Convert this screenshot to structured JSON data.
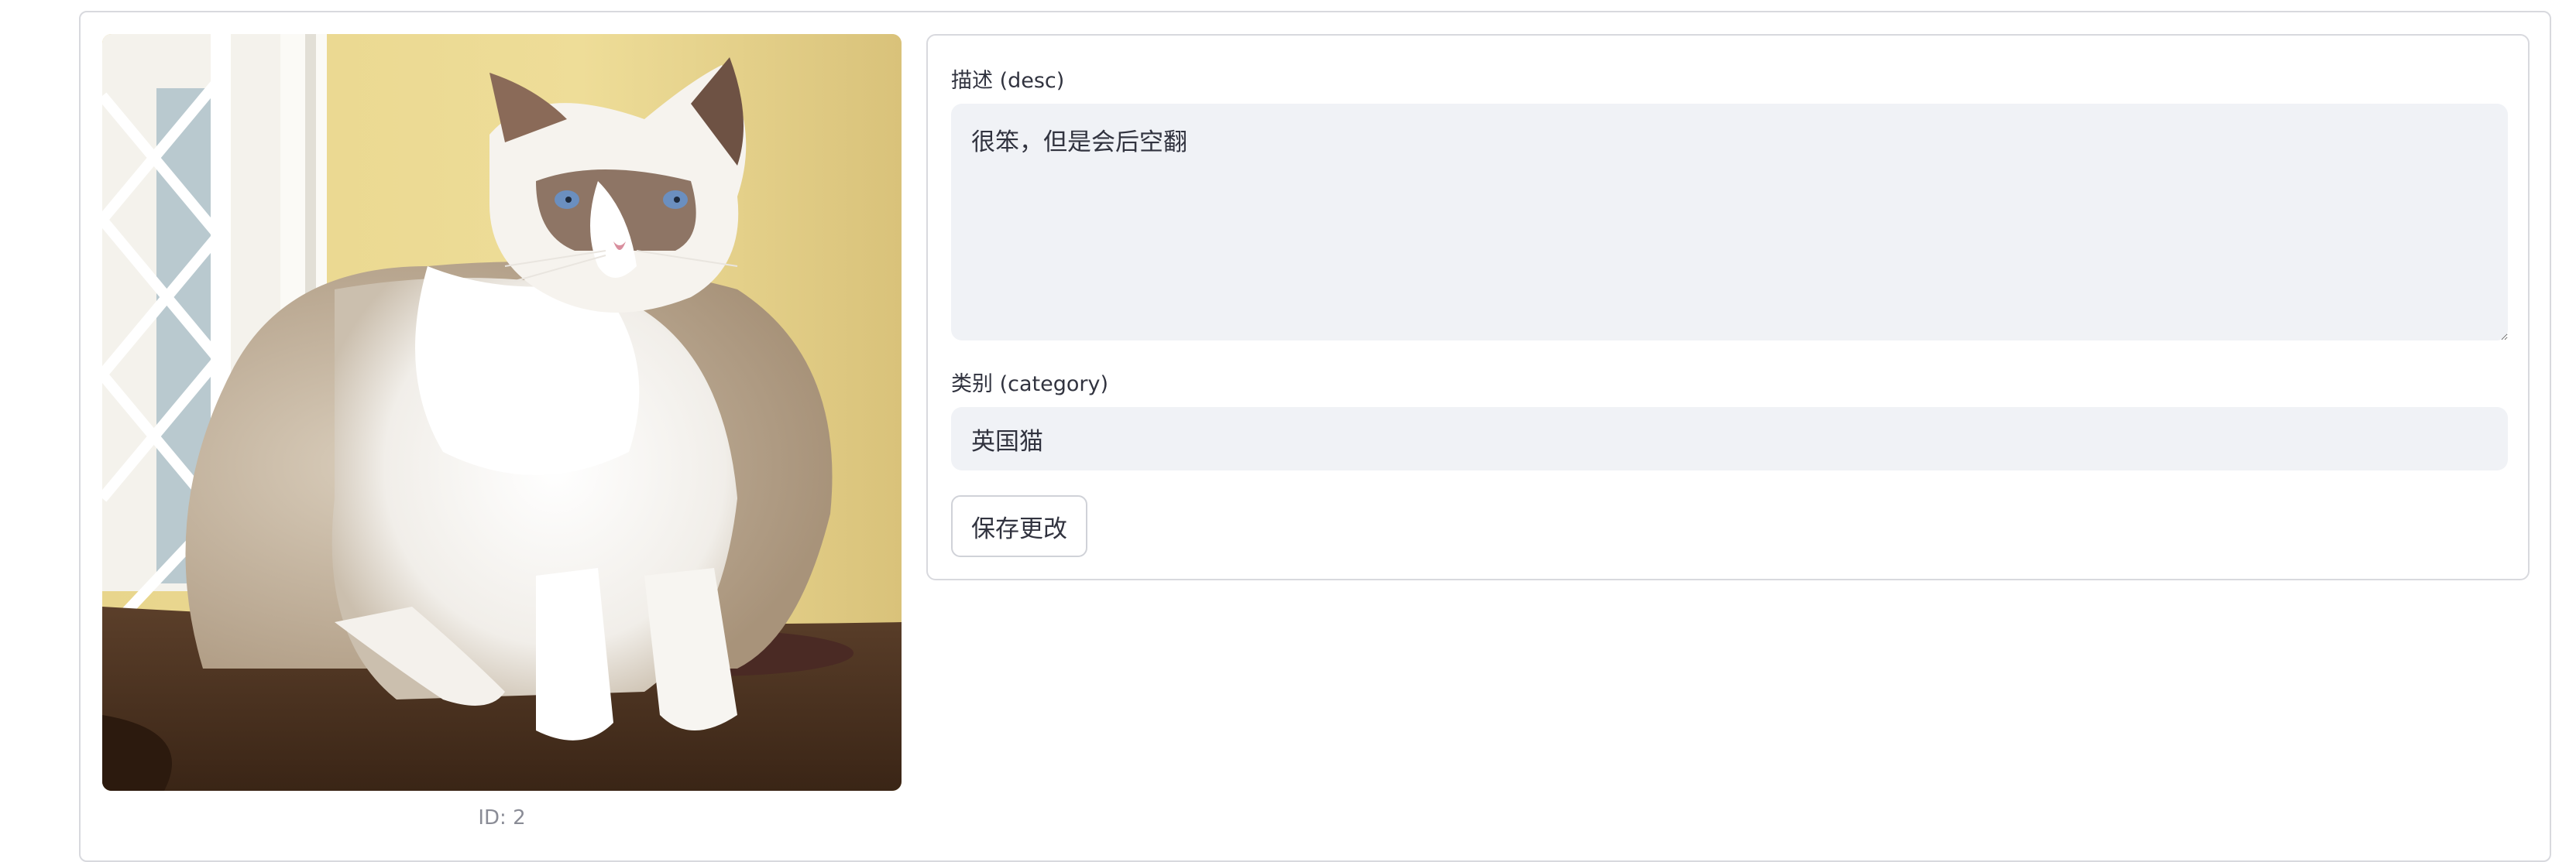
{
  "image_panel": {
    "caption": "ID: 2",
    "image_alt": "ragdoll cat"
  },
  "form": {
    "desc_label": "描述 (desc)",
    "desc_value": "很笨，但是会后空翻",
    "category_label": "类别 (category)",
    "category_value": "英国猫",
    "save_label": "保存更改"
  },
  "colors": {
    "card_border": "#d8d9de",
    "input_background": "#f0f2f6",
    "text": "#31333f",
    "caption_text": "#8a8c96"
  },
  "icons": [
    "resize-grip-icon"
  ]
}
